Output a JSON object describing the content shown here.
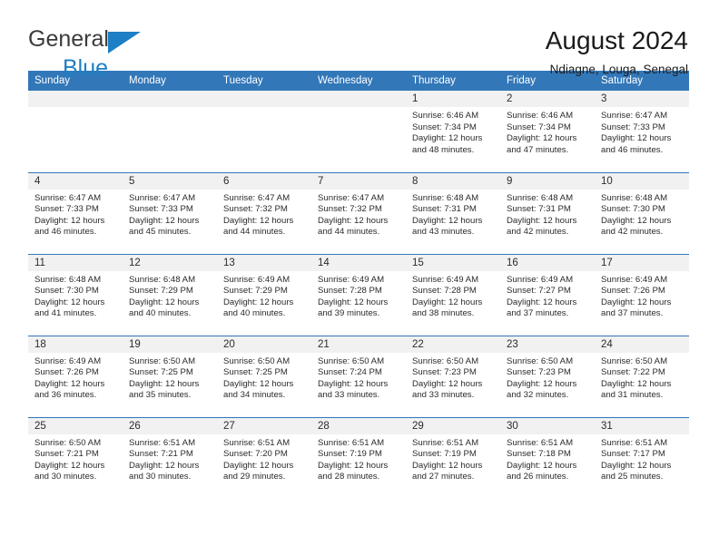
{
  "brand": {
    "name_part1": "General",
    "name_part2": "Blue",
    "triangle_color": "#1d7fc4",
    "text_color": "#3b3b3b"
  },
  "header": {
    "title": "August 2024",
    "subtitle": "Ndiagne, Louga, Senegal"
  },
  "theme": {
    "header_blue": "#3277b8",
    "daynum_gray": "#f1f1f1",
    "text_dark": "#2b2b2b"
  },
  "weekday_headers": [
    "Sunday",
    "Monday",
    "Tuesday",
    "Wednesday",
    "Thursday",
    "Friday",
    "Saturday"
  ],
  "weeks": [
    [
      {
        "day": "",
        "sunrise": "",
        "sunset": "",
        "daylight_line1": "",
        "daylight_line2": ""
      },
      {
        "day": "",
        "sunrise": "",
        "sunset": "",
        "daylight_line1": "",
        "daylight_line2": ""
      },
      {
        "day": "",
        "sunrise": "",
        "sunset": "",
        "daylight_line1": "",
        "daylight_line2": ""
      },
      {
        "day": "",
        "sunrise": "",
        "sunset": "",
        "daylight_line1": "",
        "daylight_line2": ""
      },
      {
        "day": "1",
        "sunrise": "Sunrise: 6:46 AM",
        "sunset": "Sunset: 7:34 PM",
        "daylight_line1": "Daylight: 12 hours",
        "daylight_line2": "and 48 minutes."
      },
      {
        "day": "2",
        "sunrise": "Sunrise: 6:46 AM",
        "sunset": "Sunset: 7:34 PM",
        "daylight_line1": "Daylight: 12 hours",
        "daylight_line2": "and 47 minutes."
      },
      {
        "day": "3",
        "sunrise": "Sunrise: 6:47 AM",
        "sunset": "Sunset: 7:33 PM",
        "daylight_line1": "Daylight: 12 hours",
        "daylight_line2": "and 46 minutes."
      }
    ],
    [
      {
        "day": "4",
        "sunrise": "Sunrise: 6:47 AM",
        "sunset": "Sunset: 7:33 PM",
        "daylight_line1": "Daylight: 12 hours",
        "daylight_line2": "and 46 minutes."
      },
      {
        "day": "5",
        "sunrise": "Sunrise: 6:47 AM",
        "sunset": "Sunset: 7:33 PM",
        "daylight_line1": "Daylight: 12 hours",
        "daylight_line2": "and 45 minutes."
      },
      {
        "day": "6",
        "sunrise": "Sunrise: 6:47 AM",
        "sunset": "Sunset: 7:32 PM",
        "daylight_line1": "Daylight: 12 hours",
        "daylight_line2": "and 44 minutes."
      },
      {
        "day": "7",
        "sunrise": "Sunrise: 6:47 AM",
        "sunset": "Sunset: 7:32 PM",
        "daylight_line1": "Daylight: 12 hours",
        "daylight_line2": "and 44 minutes."
      },
      {
        "day": "8",
        "sunrise": "Sunrise: 6:48 AM",
        "sunset": "Sunset: 7:31 PM",
        "daylight_line1": "Daylight: 12 hours",
        "daylight_line2": "and 43 minutes."
      },
      {
        "day": "9",
        "sunrise": "Sunrise: 6:48 AM",
        "sunset": "Sunset: 7:31 PM",
        "daylight_line1": "Daylight: 12 hours",
        "daylight_line2": "and 42 minutes."
      },
      {
        "day": "10",
        "sunrise": "Sunrise: 6:48 AM",
        "sunset": "Sunset: 7:30 PM",
        "daylight_line1": "Daylight: 12 hours",
        "daylight_line2": "and 42 minutes."
      }
    ],
    [
      {
        "day": "11",
        "sunrise": "Sunrise: 6:48 AM",
        "sunset": "Sunset: 7:30 PM",
        "daylight_line1": "Daylight: 12 hours",
        "daylight_line2": "and 41 minutes."
      },
      {
        "day": "12",
        "sunrise": "Sunrise: 6:48 AM",
        "sunset": "Sunset: 7:29 PM",
        "daylight_line1": "Daylight: 12 hours",
        "daylight_line2": "and 40 minutes."
      },
      {
        "day": "13",
        "sunrise": "Sunrise: 6:49 AM",
        "sunset": "Sunset: 7:29 PM",
        "daylight_line1": "Daylight: 12 hours",
        "daylight_line2": "and 40 minutes."
      },
      {
        "day": "14",
        "sunrise": "Sunrise: 6:49 AM",
        "sunset": "Sunset: 7:28 PM",
        "daylight_line1": "Daylight: 12 hours",
        "daylight_line2": "and 39 minutes."
      },
      {
        "day": "15",
        "sunrise": "Sunrise: 6:49 AM",
        "sunset": "Sunset: 7:28 PM",
        "daylight_line1": "Daylight: 12 hours",
        "daylight_line2": "and 38 minutes."
      },
      {
        "day": "16",
        "sunrise": "Sunrise: 6:49 AM",
        "sunset": "Sunset: 7:27 PM",
        "daylight_line1": "Daylight: 12 hours",
        "daylight_line2": "and 37 minutes."
      },
      {
        "day": "17",
        "sunrise": "Sunrise: 6:49 AM",
        "sunset": "Sunset: 7:26 PM",
        "daylight_line1": "Daylight: 12 hours",
        "daylight_line2": "and 37 minutes."
      }
    ],
    [
      {
        "day": "18",
        "sunrise": "Sunrise: 6:49 AM",
        "sunset": "Sunset: 7:26 PM",
        "daylight_line1": "Daylight: 12 hours",
        "daylight_line2": "and 36 minutes."
      },
      {
        "day": "19",
        "sunrise": "Sunrise: 6:50 AM",
        "sunset": "Sunset: 7:25 PM",
        "daylight_line1": "Daylight: 12 hours",
        "daylight_line2": "and 35 minutes."
      },
      {
        "day": "20",
        "sunrise": "Sunrise: 6:50 AM",
        "sunset": "Sunset: 7:25 PM",
        "daylight_line1": "Daylight: 12 hours",
        "daylight_line2": "and 34 minutes."
      },
      {
        "day": "21",
        "sunrise": "Sunrise: 6:50 AM",
        "sunset": "Sunset: 7:24 PM",
        "daylight_line1": "Daylight: 12 hours",
        "daylight_line2": "and 33 minutes."
      },
      {
        "day": "22",
        "sunrise": "Sunrise: 6:50 AM",
        "sunset": "Sunset: 7:23 PM",
        "daylight_line1": "Daylight: 12 hours",
        "daylight_line2": "and 33 minutes."
      },
      {
        "day": "23",
        "sunrise": "Sunrise: 6:50 AM",
        "sunset": "Sunset: 7:23 PM",
        "daylight_line1": "Daylight: 12 hours",
        "daylight_line2": "and 32 minutes."
      },
      {
        "day": "24",
        "sunrise": "Sunrise: 6:50 AM",
        "sunset": "Sunset: 7:22 PM",
        "daylight_line1": "Daylight: 12 hours",
        "daylight_line2": "and 31 minutes."
      }
    ],
    [
      {
        "day": "25",
        "sunrise": "Sunrise: 6:50 AM",
        "sunset": "Sunset: 7:21 PM",
        "daylight_line1": "Daylight: 12 hours",
        "daylight_line2": "and 30 minutes."
      },
      {
        "day": "26",
        "sunrise": "Sunrise: 6:51 AM",
        "sunset": "Sunset: 7:21 PM",
        "daylight_line1": "Daylight: 12 hours",
        "daylight_line2": "and 30 minutes."
      },
      {
        "day": "27",
        "sunrise": "Sunrise: 6:51 AM",
        "sunset": "Sunset: 7:20 PM",
        "daylight_line1": "Daylight: 12 hours",
        "daylight_line2": "and 29 minutes."
      },
      {
        "day": "28",
        "sunrise": "Sunrise: 6:51 AM",
        "sunset": "Sunset: 7:19 PM",
        "daylight_line1": "Daylight: 12 hours",
        "daylight_line2": "and 28 minutes."
      },
      {
        "day": "29",
        "sunrise": "Sunrise: 6:51 AM",
        "sunset": "Sunset: 7:19 PM",
        "daylight_line1": "Daylight: 12 hours",
        "daylight_line2": "and 27 minutes."
      },
      {
        "day": "30",
        "sunrise": "Sunrise: 6:51 AM",
        "sunset": "Sunset: 7:18 PM",
        "daylight_line1": "Daylight: 12 hours",
        "daylight_line2": "and 26 minutes."
      },
      {
        "day": "31",
        "sunrise": "Sunrise: 6:51 AM",
        "sunset": "Sunset: 7:17 PM",
        "daylight_line1": "Daylight: 12 hours",
        "daylight_line2": "and 25 minutes."
      }
    ]
  ]
}
